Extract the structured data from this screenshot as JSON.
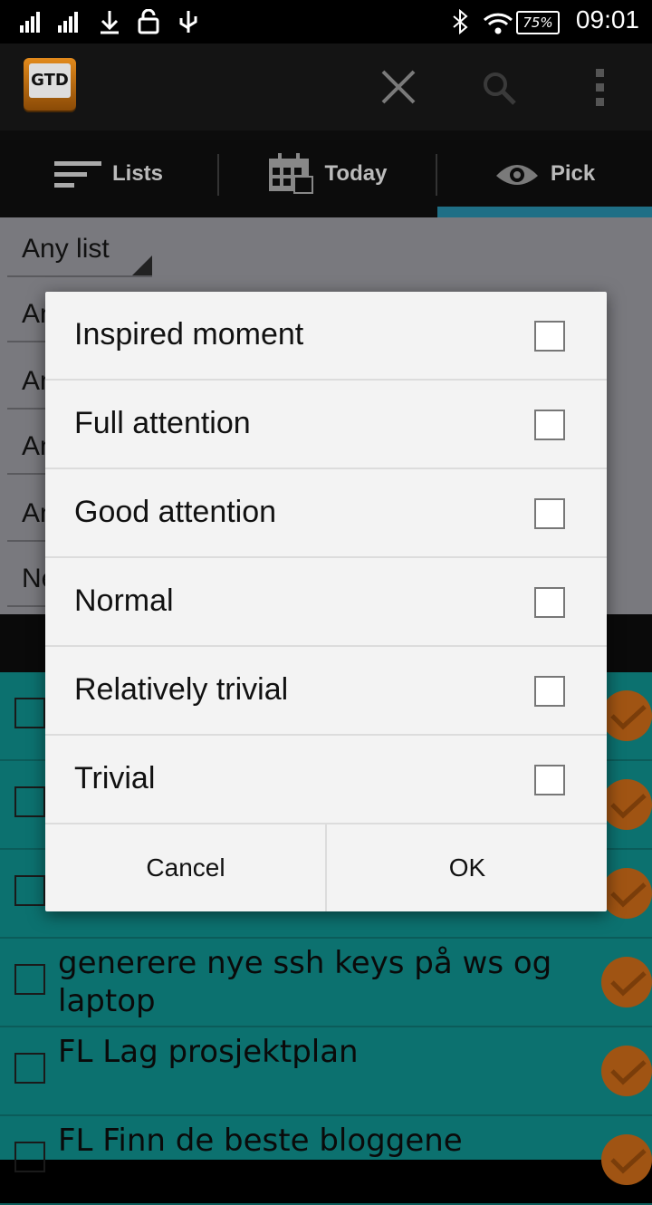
{
  "status_bar": {
    "battery": "75%",
    "time": "09:01"
  },
  "app": {
    "logo_text": "GTD"
  },
  "tabs": [
    {
      "label": "Lists",
      "icon": "lists-icon"
    },
    {
      "label": "Today",
      "icon": "calendar-icon"
    },
    {
      "label": "Pick",
      "icon": "eye-icon"
    }
  ],
  "filters": [
    "Any list",
    "An",
    "An",
    "An",
    "An",
    "Ne"
  ],
  "tasks": [
    {
      "text": ""
    },
    {
      "text": ""
    },
    {
      "text": ""
    },
    {
      "text": "generere nye ssh keys på ws og laptop"
    },
    {
      "text": "FL Lag prosjektplan"
    },
    {
      "text": "FL Finn de beste bloggene"
    }
  ],
  "dialog": {
    "options": [
      {
        "label": "Inspired moment",
        "checked": false
      },
      {
        "label": "Full attention",
        "checked": false
      },
      {
        "label": "Good attention",
        "checked": false
      },
      {
        "label": "Normal",
        "checked": false
      },
      {
        "label": "Relatively trivial",
        "checked": false
      },
      {
        "label": "Trivial",
        "checked": false
      }
    ],
    "cancel_label": "Cancel",
    "ok_label": "OK"
  },
  "colors": {
    "accent": "#1f6f86",
    "task_bg": "#0c716f",
    "check_orange": "#a05413"
  }
}
